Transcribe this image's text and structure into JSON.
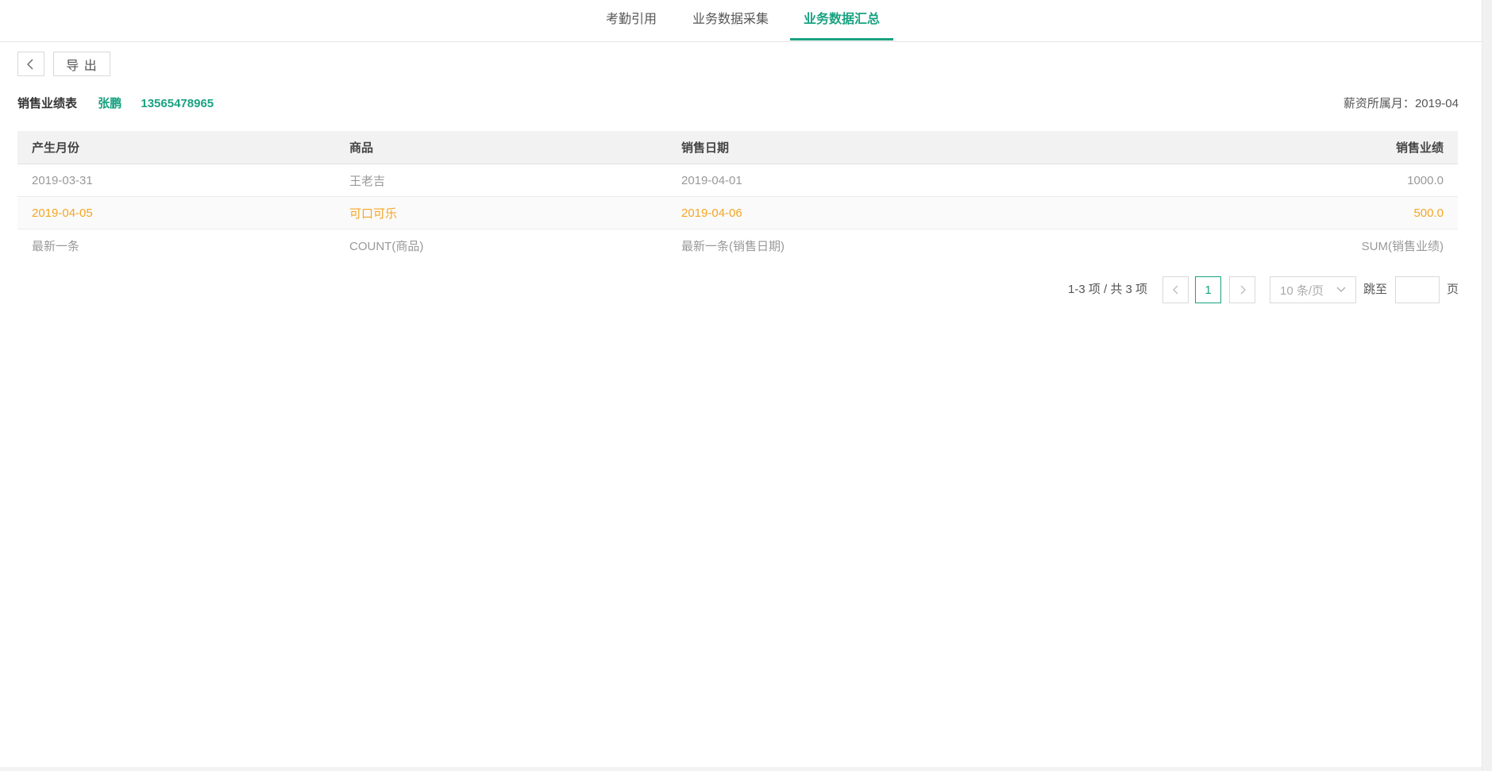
{
  "tabs": [
    {
      "label": "考勤引用"
    },
    {
      "label": "业务数据采集"
    },
    {
      "label": "业务数据汇总"
    }
  ],
  "toolbar": {
    "back_icon": "chevron-left-icon",
    "export_label": "导 出"
  },
  "info": {
    "title": "销售业绩表",
    "name": "张鹏",
    "phone": "13565478965",
    "salary_month_label": "薪资所属月：",
    "salary_month_value": "2019-04"
  },
  "table": {
    "headers": [
      "产生月份",
      "商品",
      "销售日期",
      "销售业绩"
    ],
    "rows": [
      [
        "2019-03-31",
        "王老吉",
        "2019-04-01",
        "1000.0"
      ],
      [
        "2019-04-05",
        "可口可乐",
        "2019-04-06",
        "500.0"
      ],
      [
        "最新一条",
        "COUNT(商品)",
        "最新一条(销售日期)",
        "SUM(销售业绩)"
      ]
    ],
    "highlight_color": "#f5a623"
  },
  "pagination": {
    "summary": "1-3 项 / 共 3 项",
    "current_page": "1",
    "page_size": "10 条/页",
    "jump_label": "跳至",
    "jump_value": "",
    "page_suffix": "页"
  },
  "colors": {
    "accent": "#1aa281"
  }
}
